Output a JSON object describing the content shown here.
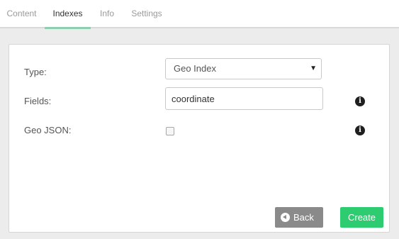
{
  "tabs": [
    {
      "label": "Content",
      "active": false
    },
    {
      "label": "Indexes",
      "active": true
    },
    {
      "label": "Info",
      "active": false
    },
    {
      "label": "Settings",
      "active": false
    }
  ],
  "form": {
    "type_label": "Type:",
    "type_value": "Geo Index",
    "fields_label": "Fields:",
    "fields_value": "coordinate",
    "geojson_label": "Geo JSON:",
    "geojson_checked": false
  },
  "buttons": {
    "back_label": "Back",
    "create_label": "Create"
  },
  "colors": {
    "active_tab_underline": "#8fcfb0",
    "create_button": "#2ecc71",
    "back_button": "#8a8a8a"
  },
  "icons": {
    "info": "info-icon",
    "back": "arrow-left-circle-icon",
    "dropdown": "caret-down-icon"
  }
}
